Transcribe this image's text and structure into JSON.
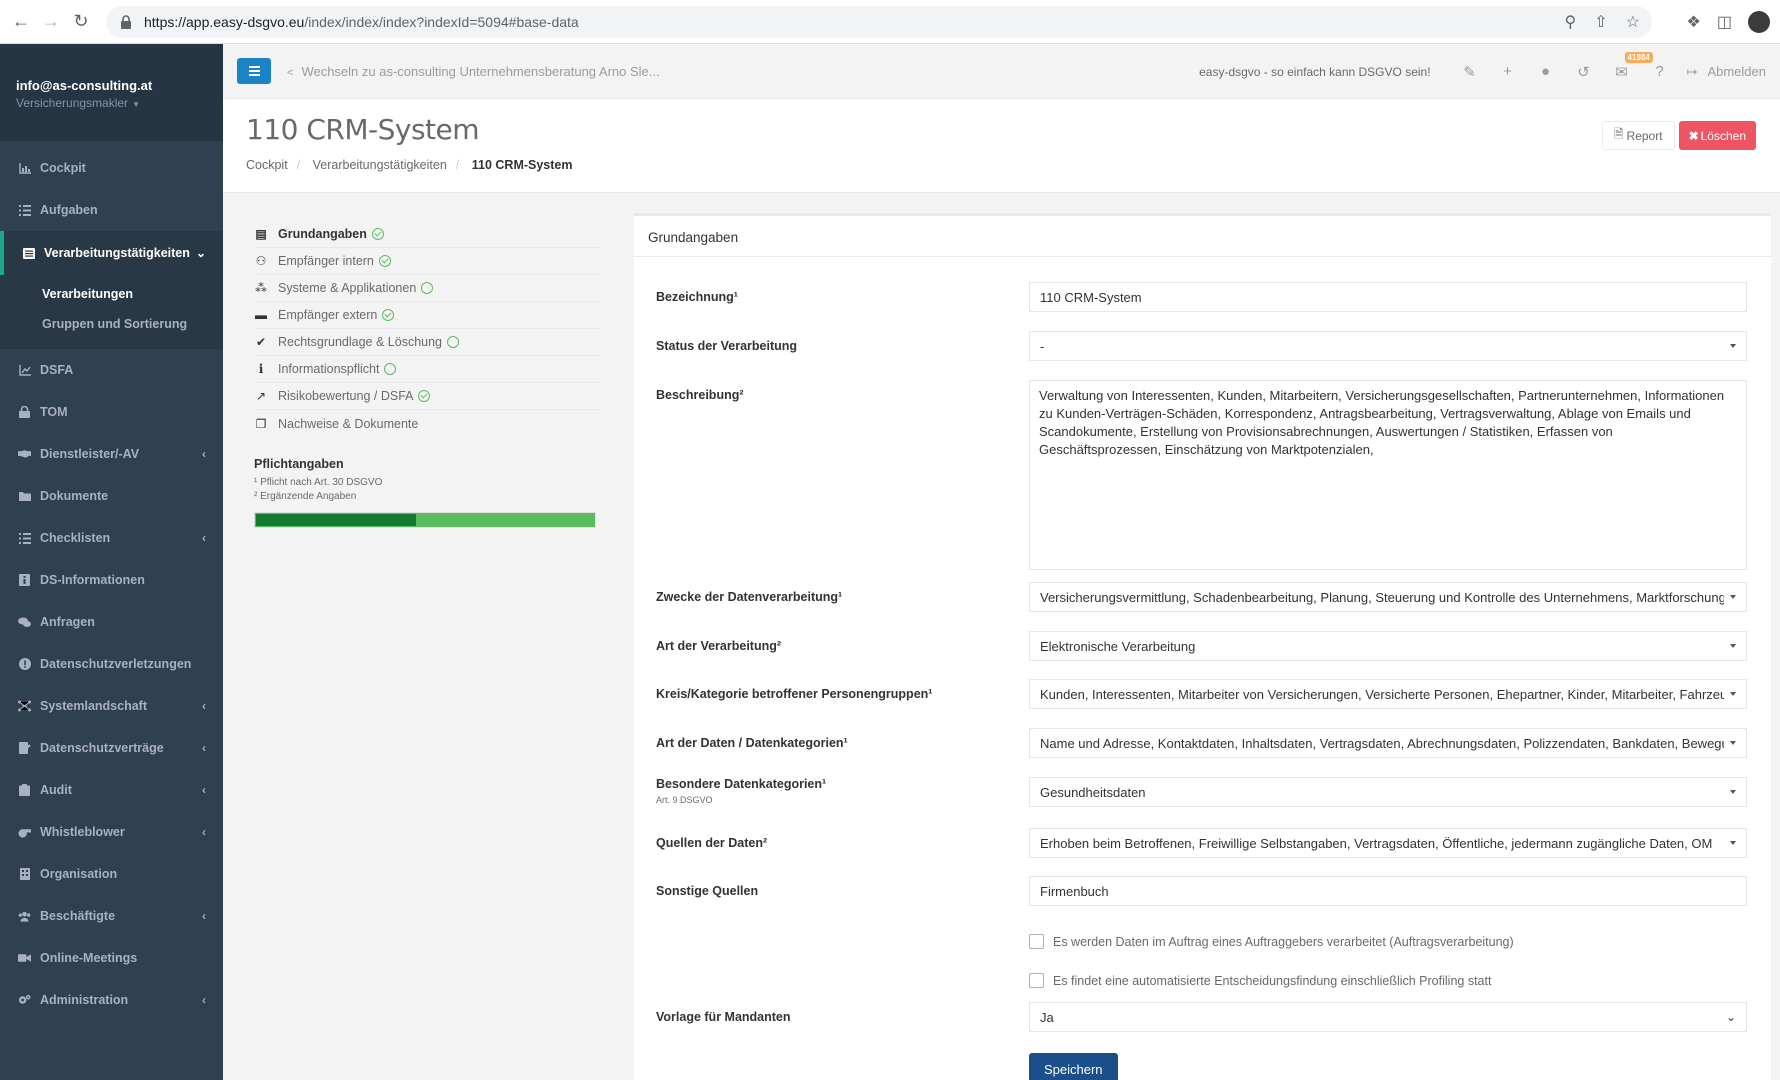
{
  "browser": {
    "url_host": "https://app.easy-dsgvo.eu",
    "url_path": "/index/index/index?indexId=5094#base-data"
  },
  "sidebar": {
    "user_email": "info@as-consulting.at",
    "user_role": "Versicherungsmakler",
    "items": [
      {
        "label": "Cockpit",
        "icon": "chart-icon"
      },
      {
        "label": "Aufgaben",
        "icon": "tasks-icon"
      },
      {
        "label": "Verarbeitungstätigkeiten",
        "icon": "list-icon"
      },
      {
        "label": "DSFA",
        "icon": "line-chart-icon"
      },
      {
        "label": "TOM",
        "icon": "lock-icon"
      },
      {
        "label": "Dienstleister/-AV",
        "icon": "handshake-icon"
      },
      {
        "label": "Dokumente",
        "icon": "folder-icon"
      },
      {
        "label": "Checklisten",
        "icon": "checklist-icon"
      },
      {
        "label": "DS-Informationen",
        "icon": "info-card-icon"
      },
      {
        "label": "Anfragen",
        "icon": "chat-icon"
      },
      {
        "label": "Datenschutzverletzungen",
        "icon": "alert-icon"
      },
      {
        "label": "Systemlandschaft",
        "icon": "network-icon"
      },
      {
        "label": "Datenschutzverträge",
        "icon": "contract-icon"
      },
      {
        "label": "Audit",
        "icon": "clipboard-icon"
      },
      {
        "label": "Whistleblower",
        "icon": "whistle-icon"
      },
      {
        "label": "Organisation",
        "icon": "building-icon"
      },
      {
        "label": "Beschäftigte",
        "icon": "users-icon"
      },
      {
        "label": "Online-Meetings",
        "icon": "video-icon"
      },
      {
        "label": "Administration",
        "icon": "cogs-icon"
      }
    ],
    "subitems": [
      "Verarbeitungen",
      "Gruppen und Sortierung"
    ]
  },
  "topbar": {
    "switch_text": "Wechseln zu as-consulting Unternehmensberatung Arno Sle...",
    "tagline": "easy-dsgvo - so einfach kann DSGVO sein!",
    "mail_count": "41984",
    "logout": "Abmelden"
  },
  "heading": {
    "title": "110 CRM-System",
    "breadcrumb": [
      "Cockpit",
      "Verarbeitungstätigkeiten",
      "110 CRM-System"
    ],
    "report_label": "Report",
    "delete_label": "Löschen"
  },
  "steps": {
    "items": [
      {
        "label": "Grundangaben",
        "status": "done"
      },
      {
        "label": "Empfänger intern",
        "status": "done"
      },
      {
        "label": "Systeme & Applikationen",
        "status": "open"
      },
      {
        "label": "Empfänger extern",
        "status": "done"
      },
      {
        "label": "Rechtsgrundlage & Löschung",
        "status": "open"
      },
      {
        "label": "Informationspflicht",
        "status": "open"
      },
      {
        "label": "Risikobewertung / DSFA",
        "status": "done"
      },
      {
        "label": "Nachweise & Dokumente",
        "status": "none"
      }
    ],
    "pflicht_title": "Pflichtangaben",
    "note1": "¹ Pflicht nach Art. 30 DSGVO",
    "note2": "² Ergänzende Angaben",
    "progress": 0.47
  },
  "form": {
    "panel_title": "Grundangaben",
    "bezeichnung_label": "Bezeichnung¹",
    "bezeichnung_value": "110 CRM-System",
    "status_label": "Status der Verarbeitung",
    "status_value": "-",
    "beschreibung_label": "Beschreibung²",
    "beschreibung_value": "Verwaltung von Interessenten, Kunden, Mitarbeitern, Versicherungsgesellschaften, Partnerunternehmen, Informationen zu Kunden-Verträgen-Schäden, Korrespondenz, Antragsbearbeitung, Vertragsverwaltung, Ablage von Emails und Scandokumente, Erstellung von Provisionsabrechnungen, Auswertungen / Statistiken, Erfassen von Geschäftsprozessen, Einschätzung von Marktpotenzialen,",
    "zwecke_label": "Zwecke der Datenverarbeitung¹",
    "zwecke_value": "Versicherungsvermittlung, Schadenbearbeitung, Planung, Steuerung und Kontrolle des Unternehmens, Marktforschung",
    "art_label": "Art der Verarbeitung²",
    "art_value": "Elektronische Verarbeitung",
    "kreis_label": "Kreis/Kategorie betroffener Personengruppen¹",
    "kreis_value": "Kunden, Interessenten, Mitarbeiter von Versicherungen, Versicherte Personen, Ehepartner, Kinder, Mitarbeiter, Fahrzeuge",
    "daten_label": "Art der Daten / Datenkategorien¹",
    "daten_value": "Name und Adresse, Kontaktdaten, Inhaltsdaten, Vertragsdaten, Abrechnungsdaten, Polizzendaten, Bankdaten, Bewegungsdaten",
    "besondere_label": "Besondere Datenkategorien¹",
    "besondere_sub": "Art. 9 DSGVO",
    "besondere_value": "Gesundheitsdaten",
    "quellen_label": "Quellen der Daten²",
    "quellen_value": "Erhoben beim Betroffenen, Freiwillige Selbstangaben, Vertragsdaten, Öffentliche, jedermann zugängliche Daten, OM",
    "sonstige_label": "Sonstige Quellen",
    "sonstige_value": "Firmenbuch",
    "check1": "Es werden Daten im Auftrag eines Auftraggebers verarbeitet (Auftragsverarbeitung)",
    "check2": "Es findet eine automatisierte Entscheidungsfindung einschließlich Profiling statt",
    "vorlage_label": "Vorlage für Mandanten",
    "vorlage_value": "Ja",
    "save_label": "Speichern"
  }
}
